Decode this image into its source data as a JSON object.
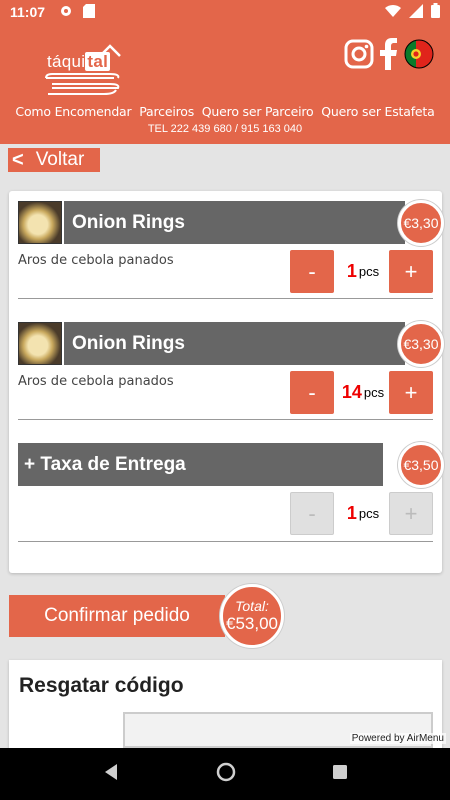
{
  "status": {
    "time": "11:07"
  },
  "header": {
    "logo_text_pre": "táqui",
    "logo_text_tal": "tal",
    "nav": [
      "Como Encomendar",
      "Parceiros",
      "Quero ser Parceiro",
      "Quero ser Estafeta"
    ],
    "phone": "TEL 222 439 680 / 915 163 040"
  },
  "back_label": "Voltar",
  "items": [
    {
      "name": "Onion Rings",
      "desc": "Aros de cebola panados",
      "price": "€3,30",
      "qty": "1",
      "unit": "pcs"
    },
    {
      "name": "Onion Rings",
      "desc": "Aros de cebola panados",
      "price": "€3,30",
      "qty": "14",
      "unit": "pcs"
    }
  ],
  "delivery": {
    "name": "+ Taxa de Entrega",
    "price": "€3,50",
    "qty": "1",
    "unit": "pcs"
  },
  "buttons": {
    "minus": "-",
    "plus": "+"
  },
  "confirm_label": "Confirmar pedido",
  "total": {
    "label": "Total:",
    "value": "€53,00"
  },
  "redeem_title": "Resgatar código",
  "powered_by": "Powered by AirMenu",
  "colors": {
    "accent": "#e3664a",
    "bar": "#666666",
    "qty": "#ee0000"
  }
}
